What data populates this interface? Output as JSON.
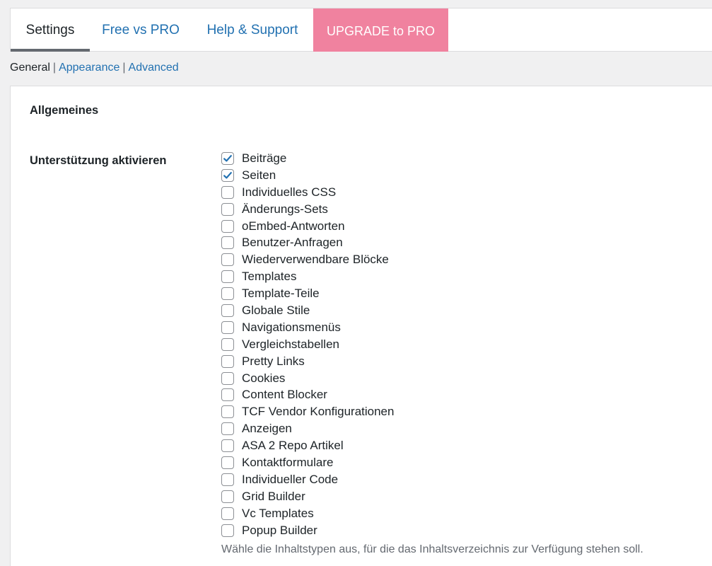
{
  "tabs": [
    {
      "label": "Settings",
      "active": true
    },
    {
      "label": "Free vs PRO",
      "active": false
    },
    {
      "label": "Help & Support",
      "active": false
    },
    {
      "label": "UPGRADE to PRO",
      "active": false
    }
  ],
  "subnav": {
    "current": "General",
    "separator": "|",
    "links": [
      "Appearance",
      "Advanced"
    ]
  },
  "section_title": "Allgemeines",
  "field_label": "Unterstützung aktivieren",
  "options": [
    {
      "label": "Beiträge",
      "checked": true
    },
    {
      "label": "Seiten",
      "checked": true
    },
    {
      "label": "Individuelles CSS",
      "checked": false
    },
    {
      "label": "Änderungs-Sets",
      "checked": false
    },
    {
      "label": "oEmbed-Antworten",
      "checked": false
    },
    {
      "label": "Benutzer-Anfragen",
      "checked": false
    },
    {
      "label": "Wiederverwendbare Blöcke",
      "checked": false
    },
    {
      "label": "Templates",
      "checked": false
    },
    {
      "label": "Template-Teile",
      "checked": false
    },
    {
      "label": "Globale Stile",
      "checked": false
    },
    {
      "label": "Navigationsmenüs",
      "checked": false
    },
    {
      "label": "Vergleichstabellen",
      "checked": false
    },
    {
      "label": "Pretty Links",
      "checked": false
    },
    {
      "label": "Cookies",
      "checked": false
    },
    {
      "label": "Content Blocker",
      "checked": false
    },
    {
      "label": "TCF Vendor Konfigurationen",
      "checked": false
    },
    {
      "label": "Anzeigen",
      "checked": false
    },
    {
      "label": "ASA 2 Repo Artikel",
      "checked": false
    },
    {
      "label": "Kontaktformulare",
      "checked": false
    },
    {
      "label": "Individueller Code",
      "checked": false
    },
    {
      "label": "Grid Builder",
      "checked": false
    },
    {
      "label": "Vc Templates",
      "checked": false
    },
    {
      "label": "Popup Builder",
      "checked": false
    }
  ],
  "description": "Wähle die Inhaltstypen aus, für die das Inhaltsverzeichnis zur Verfügung stehen soll.",
  "colors": {
    "link": "#2271b1",
    "upgrade_bg": "#f0829f",
    "checkmark": "#2271b1"
  }
}
